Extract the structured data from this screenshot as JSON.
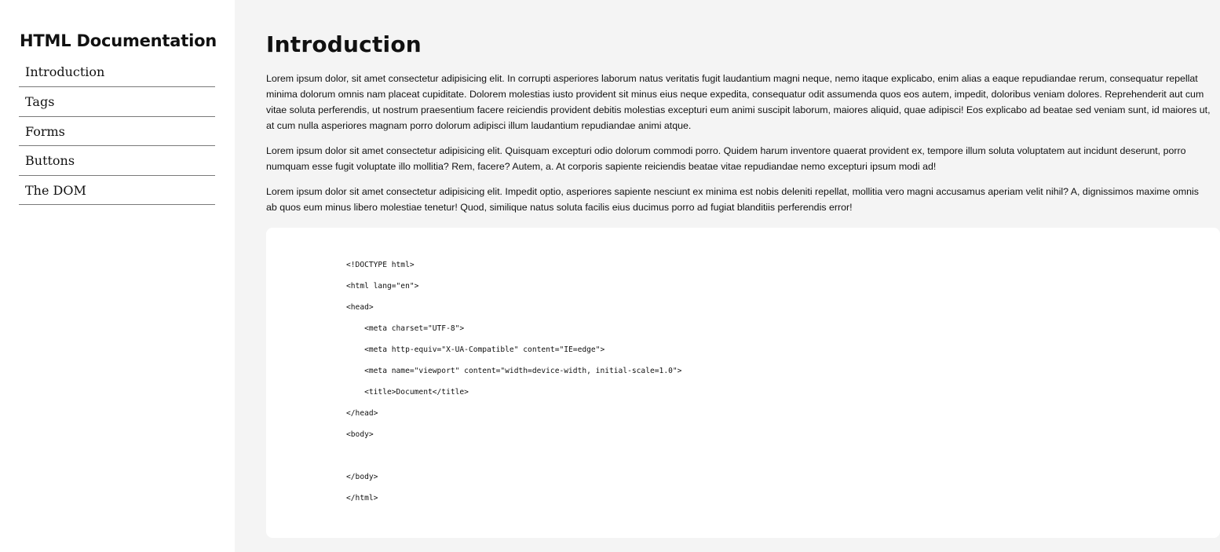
{
  "sidebar": {
    "title": "HTML Documentation",
    "items": [
      {
        "label": "Introduction"
      },
      {
        "label": "Tags"
      },
      {
        "label": "Forms"
      },
      {
        "label": "Buttons"
      },
      {
        "label": "The DOM"
      }
    ]
  },
  "main": {
    "title": "Introduction",
    "paragraphs": [
      "Lorem ipsum dolor, sit amet consectetur adipisicing elit. In corrupti asperiores laborum natus veritatis fugit laudantium magni neque, nemo itaque explicabo, enim alias a eaque repudiandae rerum, consequatur repellat minima dolorum omnis nam placeat cupiditate. Dolorem molestias iusto provident sit minus eius neque expedita, consequatur odit assumenda quos eos autem, impedit, doloribus veniam dolores. Reprehenderit aut cum vitae soluta perferendis, ut nostrum praesentium facere reiciendis provident debitis molestias excepturi eum animi suscipit laborum, maiores aliquid, quae adipisci! Eos explicabo ad beatae sed veniam sunt, id maiores ut, at cum nulla asperiores magnam porro dolorum adipisci illum laudantium repudiandae animi atque.",
      "Lorem ipsum dolor sit amet consectetur adipisicing elit. Quisquam excepturi odio dolorum commodi porro. Quidem harum inventore quaerat provident ex, tempore illum soluta voluptatem aut incidunt deserunt, porro numquam esse fugit voluptate illo mollitia? Rem, facere? Autem, a. At corporis sapiente reiciendis beatae vitae repudiandae nemo excepturi ipsum modi ad!",
      "Lorem ipsum dolor sit amet consectetur adipisicing elit. Impedit optio, asperiores sapiente nesciunt ex minima est nobis deleniti repellat, mollitia vero magni accusamus aperiam velit nihil? A, dignissimos maxime omnis ab quos eum minus libero molestiae tenetur! Quod, similique natus soluta facilis eius ducimus porro ad fugiat blanditiis perferendis error!"
    ],
    "code_lines": [
      "<!DOCTYPE html>",
      "<html lang=\"en\">",
      "<head>",
      "    <meta charset=\"UTF-8\">",
      "    <meta http-equiv=\"X-UA-Compatible\" content=\"IE=edge\">",
      "    <meta name=\"viewport\" content=\"width=device-width, initial-scale=1.0\">",
      "    <title>Document</title>",
      "</head>",
      "<body>",
      "",
      "</body>",
      "</html>"
    ]
  },
  "colors": {
    "sidebar_bg": "#ffffff",
    "main_bg": "#f4f4f4",
    "code_bg": "#ffffff",
    "nav_divider": "#7a7a7a",
    "text": "#111111"
  }
}
